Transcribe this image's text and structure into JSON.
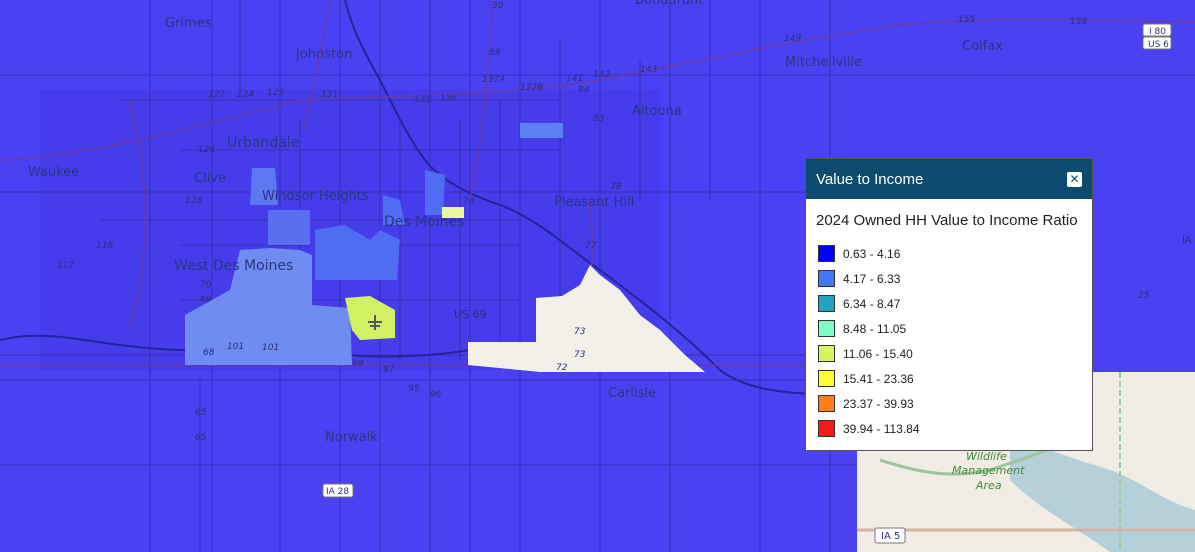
{
  "legend": {
    "title": "Value to Income",
    "close_icon": "close-icon",
    "subtitle": "2024 Owned HH Value to Income Ratio",
    "items": [
      {
        "label": "0.63 - 4.16",
        "color": "#0000ff"
      },
      {
        "label": "4.17 - 6.33",
        "color": "#3f79f5"
      },
      {
        "label": "6.34 - 8.47",
        "color": "#22a6bf"
      },
      {
        "label": "8.48 - 11.05",
        "color": "#7cffc5"
      },
      {
        "label": "11.06 - 15.40",
        "color": "#d4f55d"
      },
      {
        "label": "15.41 - 23.36",
        "color": "#ffff33"
      },
      {
        "label": "23.37 - 39.93",
        "color": "#ff7f1e"
      },
      {
        "label": "39.94 - 113.84",
        "color": "#ff1616"
      }
    ]
  },
  "map": {
    "places": {
      "grimes": "Grimes",
      "johnston": "Johnston",
      "urbandale": "Urbandale",
      "waukee": "Waukee",
      "clive": "Clive",
      "windsor_heights": "Windsor Heights",
      "des_moines": "Des Moines",
      "west_des_moines": "West Des Moines",
      "pleasant_hill": "Pleasant Hill",
      "altoona": "Altoona",
      "mitchellville": "Mitchellville",
      "colfax": "Colfax",
      "bondurant": "Bondurant",
      "norwalk": "Norwalk",
      "carlisle": "Carlisle",
      "wildlife": "Wildlife",
      "management": "Management",
      "area": "Area"
    },
    "roads": {
      "us69": "US 69",
      "ia28": "IA 28",
      "ia5": "IA 5",
      "i80": "I 80",
      "us6": "US 6",
      "r30": "30",
      "r89": "89",
      "r137a": "137A",
      "r137b": "137B",
      "r141": "141",
      "r142": "142",
      "r143": "143",
      "r149": "149",
      "r155": "155",
      "r159": "159",
      "r84": "84",
      "r83": "83",
      "r73a": "73",
      "r73b": "73",
      "r72": "72",
      "r25": "25",
      "r65a": "65",
      "r65b": "65",
      "r70": "70",
      "r69": "69",
      "r68": "68",
      "r101a": "101",
      "r101b": "101",
      "r95": "95",
      "r96": "96",
      "r97": "97",
      "r99": "99",
      "r126": "126",
      "r124": "124",
      "r127": "127",
      "r128": "128",
      "r129": "129",
      "r131": "131",
      "r135": "135",
      "r136": "136",
      "r118": "118",
      "r117": "117",
      "r79": "79",
      "r77": "77",
      "r78": "78",
      "ia_edge": "IA"
    }
  }
}
